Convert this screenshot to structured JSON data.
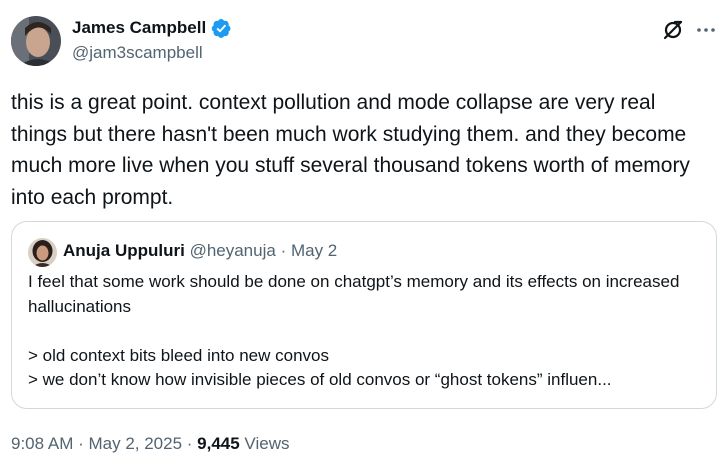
{
  "author": {
    "name": "James Campbell",
    "handle": "@jam3scampbell",
    "verified_color": "#1d9bf0"
  },
  "actions": {
    "grok_icon": "grok-icon",
    "more_icon": "more-icon"
  },
  "tweet": {
    "text": "this is a great point. context pollution and mode collapse are very real things but there hasn't been much work studying them. and they become much more live when you stuff several thousand tokens worth of memory into each prompt."
  },
  "quote": {
    "name": "Anuja Uppuluri",
    "handle": "@heyanuja",
    "separator": "·",
    "date": "May 2",
    "paragraph": "I feel that some work should be done on chatgpt’s memory and its effects on increased hallucinations",
    "line1": "> old context bits bleed into new convos",
    "line2": "> we don’t know how invisible pieces of old convos or “ghost tokens” influen..."
  },
  "meta": {
    "time": "9:08 AM",
    "separator1": " · ",
    "date": "May 2, 2025",
    "separator2": " · ",
    "views_count": "9,445",
    "views_label": " Views"
  }
}
